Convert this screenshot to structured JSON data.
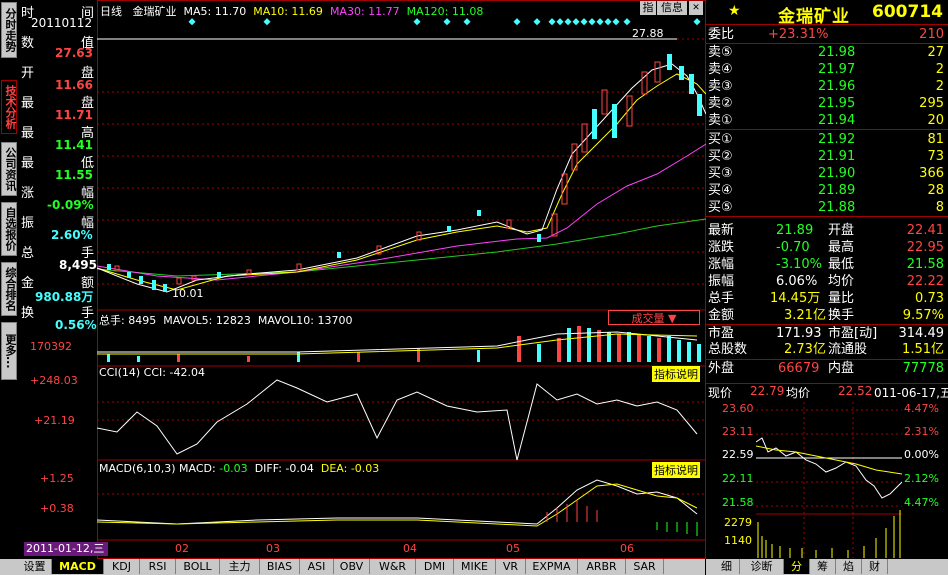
{
  "left_tabs": [
    "分时走势",
    "技术分析",
    "公司资讯",
    "自选报价",
    "综合排名",
    "更多..."
  ],
  "chart_header": {
    "period": "日线",
    "name": "金瑞矿业",
    "ma5": "MA5: 11.70",
    "ma10": "MA10: 11.69",
    "ma30": "MA30: 11.77",
    "ma120": "MA120: 11.08"
  },
  "top_buttons": {
    "btn1": "指",
    "btn2": "信息"
  },
  "datapanel": {
    "time_label": "时",
    "time_label2": "间",
    "date": "20110112",
    "val_label1": "数",
    "val_label2": "值",
    "open_label1": "开",
    "open_label2": "盘",
    "open": "27.63",
    "high_label1": "最",
    "high_label2": "盘",
    "high": "11.66",
    "low_label1": "最",
    "low_label2": "高",
    "low": "11.71",
    "close_label1": "最",
    "close_label2": "低",
    "close": "11.41",
    "chg_label1": "收",
    "chg_label2": "盘",
    "chg": "11.55",
    "pct_label1": "涨",
    "pct_label2": "幅",
    "pct": "-0.09%",
    "amp_label1": "振",
    "amp_label2": "幅",
    "amp": "2.60%",
    "vol_label1": "总",
    "vol_label2": "手",
    "vol": "8,495",
    "amt_label1": "金",
    "amt_label2": "额",
    "amt": "980.88万",
    "turn_label1": "换",
    "turn_label2": "手",
    "turn": "0.56%"
  },
  "price_annotations": {
    "high_mark": "27.88",
    "low_mark": "10.01"
  },
  "volume_header": {
    "total": "总手: 8495",
    "mavol5": "MAVOL5: 12823",
    "mavol10": "MAVOL10: 13700",
    "button": "成交量",
    "scale": "170392"
  },
  "cci_header": {
    "text": "CCI(14) CCI: -42.04",
    "help": "指标说明",
    "top": "+248.03",
    "mid": "+21.19"
  },
  "macd_header": {
    "prefix": "MACD(6,10,3) MACD: ",
    "macd": "-0.03",
    "diff": "DIFF: -0.04",
    "dea": "DEA: -0.03",
    "help": "指标说明",
    "top": "+1.25",
    "mid": "+0.38"
  },
  "x_axis": {
    "date": "2011-01-12,三",
    "m02": "02",
    "m03": "03",
    "m04": "04",
    "m05": "05",
    "m06": "06"
  },
  "bottom_tabs": [
    "设置",
    "MACD",
    "KDJ",
    "RSI",
    "BOLL",
    "主力",
    "BIAS",
    "ASI",
    "OBV",
    "W&R",
    "DMI",
    "MIKE",
    "VR",
    "EXPMA",
    "ARBR",
    "SAR"
  ],
  "stock": {
    "name": "金瑞矿业",
    "code": "600714",
    "star": "★"
  },
  "order_book": {
    "wb_label": "委比",
    "wb_pct": "+23.31%",
    "wb_val": "210",
    "asks": [
      {
        "label": "卖⑤",
        "price": "21.98",
        "vol": "27"
      },
      {
        "label": "卖④",
        "price": "21.97",
        "vol": "2"
      },
      {
        "label": "卖③",
        "price": "21.96",
        "vol": "2"
      },
      {
        "label": "卖②",
        "price": "21.95",
        "vol": "295"
      },
      {
        "label": "卖①",
        "price": "21.94",
        "vol": "20"
      }
    ],
    "bids": [
      {
        "label": "买①",
        "price": "21.92",
        "vol": "81"
      },
      {
        "label": "买②",
        "price": "21.91",
        "vol": "73"
      },
      {
        "label": "买③",
        "price": "21.90",
        "vol": "366"
      },
      {
        "label": "买④",
        "price": "21.89",
        "vol": "28"
      },
      {
        "label": "买⑤",
        "price": "21.88",
        "vol": "8"
      }
    ]
  },
  "quote": {
    "r1": {
      "l1": "最新",
      "v1": "21.89",
      "l2": "开盘",
      "v2": "22.41"
    },
    "r2": {
      "l1": "涨跌",
      "v1": "-0.70",
      "l2": "最高",
      "v2": "22.95"
    },
    "r3": {
      "l1": "涨幅",
      "v1": "-3.10%",
      "l2": "最低",
      "v2": "21.58"
    },
    "r4": {
      "l1": "振幅",
      "v1": "6.06%",
      "l2": "均价",
      "v2": "22.22"
    },
    "r5": {
      "l1": "总手",
      "v1": "14.45万",
      "l2": "量比",
      "v2": "0.73"
    },
    "r6": {
      "l1": "金额",
      "v1": "3.21亿",
      "l2": "换手",
      "v2": "9.57%"
    },
    "r7": {
      "l1": "市盈",
      "v1": "171.93",
      "l2": "市盈[动]",
      "v2": "314.49"
    },
    "r8": {
      "l1": "总股数",
      "v1": "2.73亿",
      "l2": "流通股",
      "v2": "1.51亿"
    },
    "r9": {
      "l1": "外盘",
      "v1": "66679",
      "l2": "内盘",
      "v2": "77778"
    }
  },
  "intraday": {
    "header_label": "现价",
    "price": "22.79",
    "avg_label": "均价",
    "avg": "22.52",
    "date": "011-06-17,五",
    "y_left": [
      "23.60",
      "23.11",
      "22.59",
      "22.11",
      "21.58"
    ],
    "y_right": [
      "4.47%",
      "2.31%",
      "0.00%",
      "2.12%",
      "4.47%"
    ],
    "vol_labels": [
      "2279",
      "1140"
    ]
  },
  "right_tabs": [
    "细",
    "诊断",
    "分",
    "筹",
    "焰",
    "财"
  ]
}
